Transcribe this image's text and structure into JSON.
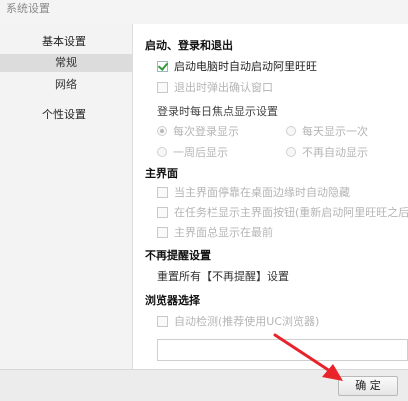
{
  "window": {
    "title": "系统设置"
  },
  "sidebar": {
    "basic": "基本设置",
    "general": "常规",
    "network": "网络",
    "personal": "个性设置"
  },
  "startup": {
    "heading": "启动、登录和退出",
    "auto_start": {
      "label": "启动电脑时自动启动阿里旺旺",
      "checked": true
    },
    "exit_confirm": {
      "label": "退出时弹出确认窗口",
      "checked": false
    },
    "focus_heading": "登录时每日焦点显示设置",
    "focus_options": [
      {
        "label": "每次登录显示",
        "selected": true
      },
      {
        "label": "每天显示一次",
        "selected": false
      },
      {
        "label": "一周后显示",
        "selected": false
      },
      {
        "label": "不再自动显示",
        "selected": false
      }
    ]
  },
  "main_panel": {
    "heading": "主界面",
    "options": [
      {
        "label": "当主界面停靠在桌面边缘时自动隐藏",
        "checked": false
      },
      {
        "label": "在任务栏显示主界面按钮(重新启动阿里旺旺之后生",
        "checked": false
      },
      {
        "label": "主界面总显示在最前",
        "checked": false
      }
    ]
  },
  "no_remind": {
    "heading": "不再提醒设置",
    "reset_text": "重置所有【不再提醒】设置"
  },
  "browser": {
    "heading": "浏览器选择",
    "auto_detect": {
      "label": "自动检测(推荐使用UC浏览器)",
      "checked": false
    },
    "path_value": ""
  },
  "footer": {
    "ok_label": "确 定"
  },
  "colors": {
    "arrow": "#e8232a",
    "check": "#2e9a3a"
  }
}
